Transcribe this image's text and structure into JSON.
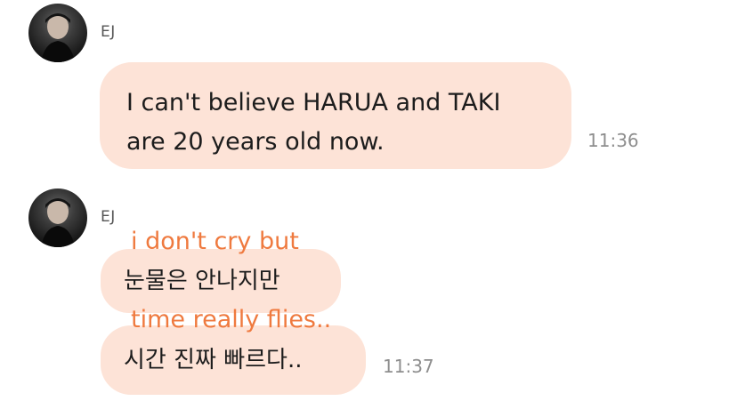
{
  "messages": [
    {
      "sender": "EJ",
      "text": "I can't believe HARUA and TAKI are 20 years old now.",
      "time": "11:36"
    },
    {
      "sender": "EJ",
      "bubbles": [
        "눈물은 안나지만",
        "시간 진짜 빠르다.."
      ],
      "time": "11:37"
    }
  ],
  "translations": [
    "i don't cry but",
    "time really flies.."
  ],
  "colors": {
    "bubble": "#fde3d7",
    "translation_text": "#ef7a3f",
    "timestamp": "#8e8e8e"
  },
  "icons": {
    "avatar": "profile-photo"
  }
}
